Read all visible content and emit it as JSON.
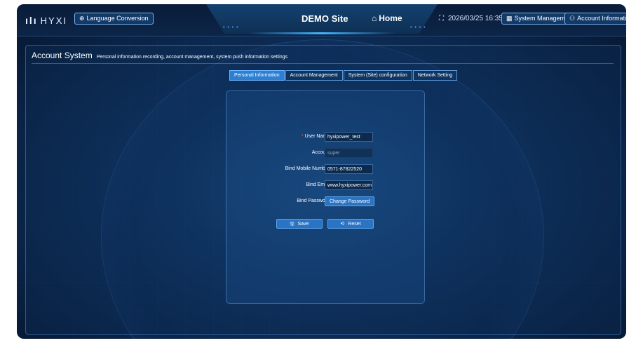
{
  "header": {
    "logo_text": "HYXI",
    "language_button": "Language Conversion",
    "site_title": "DEMO Site",
    "home_label": "Home",
    "datetime": "2026/03/25 16:35",
    "system_button": "System Management",
    "account_button": "Account Information",
    "icons": [
      "logo-icon",
      "globe-icon",
      "home-icon",
      "fullscreen-icon",
      "grid-icon",
      "user-icon"
    ]
  },
  "panel": {
    "title": "Account System",
    "subtitle": "Personal information recording, account management, system push information settings"
  },
  "tabs": [
    {
      "label": "Personal Information",
      "active": true
    },
    {
      "label": "Account Management",
      "active": false
    },
    {
      "label": "System (Site) configuration",
      "active": false
    },
    {
      "label": "Network Setting",
      "active": false
    }
  ],
  "form": {
    "required_mark": "*",
    "user_name_label": "User Name:",
    "user_name_value": "hyxipower_test",
    "account_label": "Account:",
    "account_value": "super",
    "mobile_label": "Bind Mobile Number:",
    "mobile_value": "0571-87822520",
    "email_label": "Bind Email:",
    "email_value": "www.hyxipower.com",
    "password_label": "Bind Password:",
    "change_password_button": "Change Password",
    "save_button": "Save",
    "reset_button": "Reset"
  },
  "colors": {
    "accent": "#2b74c4",
    "active_tab": "#2d7fd2",
    "required": "#ff4d4f",
    "background": "#0f3564"
  }
}
